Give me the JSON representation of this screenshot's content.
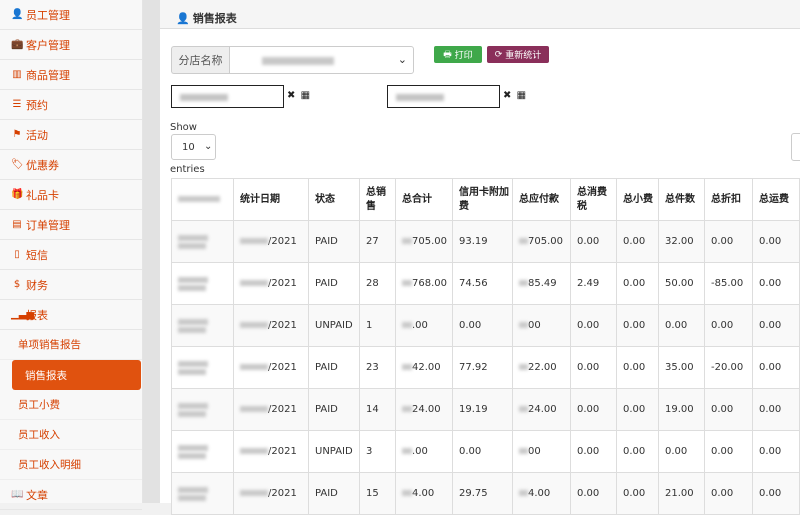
{
  "sidebar": {
    "items": [
      {
        "label": "员工管理",
        "icon": "user-icon",
        "glyph": "👤"
      },
      {
        "label": "客户管理",
        "icon": "briefcase-icon",
        "glyph": "💼"
      },
      {
        "label": "商品管理",
        "icon": "barcode-icon",
        "glyph": "▥"
      },
      {
        "label": "预约",
        "icon": "list-icon",
        "glyph": "☰"
      },
      {
        "label": "活动",
        "icon": "flag-icon",
        "glyph": "⚑"
      },
      {
        "label": "优惠券",
        "icon": "tag-icon",
        "glyph": "🏷"
      },
      {
        "label": "礼品卡",
        "icon": "gift-icon",
        "glyph": "🎁"
      },
      {
        "label": "订单管理",
        "icon": "order-icon",
        "glyph": "▤"
      },
      {
        "label": "短信",
        "icon": "mobile-icon",
        "glyph": "▯"
      },
      {
        "label": "财务",
        "icon": "dollar-icon",
        "glyph": "$"
      },
      {
        "label": "报表",
        "icon": "signal-icon",
        "glyph": "▁▃▅"
      }
    ],
    "subitems": [
      {
        "label": "单项销售报告",
        "active": false
      },
      {
        "label": "销售报表",
        "active": true
      },
      {
        "label": "员工小费",
        "active": false
      },
      {
        "label": "员工收入",
        "active": false
      },
      {
        "label": "员工收入明细",
        "active": false
      }
    ],
    "last_item": {
      "label": "文章",
      "icon": "book-icon",
      "glyph": "📖"
    }
  },
  "panel": {
    "title": "销售报表",
    "icon": "user-icon"
  },
  "filters": {
    "store_label": "分店名称",
    "print_label": "打印",
    "recalc_label": "重新统计",
    "date_icons": "✖ ▦"
  },
  "paging": {
    "show_label": "Show",
    "page_size": "10",
    "entries_label": "entries"
  },
  "table": {
    "headers": [
      "",
      "统计日期",
      "状态",
      "总销售",
      "总合计",
      "信用卡附加费",
      "总应付款",
      "总消费税",
      "总小费",
      "总件数",
      "总折扣",
      "总运费"
    ],
    "rows": [
      {
        "date": "/2021",
        "status": "PAID",
        "count": "27",
        "total": "705.00",
        "surcharge": "93.19",
        "payable": "705.00",
        "tax": "0.00",
        "tip": "0.00",
        "pieces": "32.00",
        "discount": "0.00",
        "shipping": "0.00"
      },
      {
        "date": "/2021",
        "status": "PAID",
        "count": "28",
        "total": "768.00",
        "surcharge": "74.56",
        "payable": "85.49",
        "tax": "2.49",
        "tip": "0.00",
        "pieces": "50.00",
        "discount": "-85.00",
        "shipping": "0.00"
      },
      {
        "date": "/2021",
        "status": "UNPAID",
        "count": "1",
        "total": ".00",
        "surcharge": "0.00",
        "payable": "00",
        "tax": "0.00",
        "tip": "0.00",
        "pieces": "0.00",
        "discount": "0.00",
        "shipping": "0.00"
      },
      {
        "date": "/2021",
        "status": "PAID",
        "count": "23",
        "total": "42.00",
        "surcharge": "77.92",
        "payable": "22.00",
        "tax": "0.00",
        "tip": "0.00",
        "pieces": "35.00",
        "discount": "-20.00",
        "shipping": "0.00"
      },
      {
        "date": "/2021",
        "status": "PAID",
        "count": "14",
        "total": "24.00",
        "surcharge": "19.19",
        "payable": "24.00",
        "tax": "0.00",
        "tip": "0.00",
        "pieces": "19.00",
        "discount": "0.00",
        "shipping": "0.00"
      },
      {
        "date": "/2021",
        "status": "UNPAID",
        "count": "3",
        "total": ".00",
        "surcharge": "0.00",
        "payable": "00",
        "tax": "0.00",
        "tip": "0.00",
        "pieces": "0.00",
        "discount": "0.00",
        "shipping": "0.00"
      },
      {
        "date": "/2021",
        "status": "PAID",
        "count": "15",
        "total": "4.00",
        "surcharge": "29.75",
        "payable": "4.00",
        "tax": "0.00",
        "tip": "0.00",
        "pieces": "21.00",
        "discount": "0.00",
        "shipping": "0.00"
      }
    ]
  },
  "colors": {
    "accent": "#d64000",
    "active_bg": "#e0520f",
    "print_btn": "#3fa84a",
    "recalc_btn": "#8a2f5a"
  }
}
